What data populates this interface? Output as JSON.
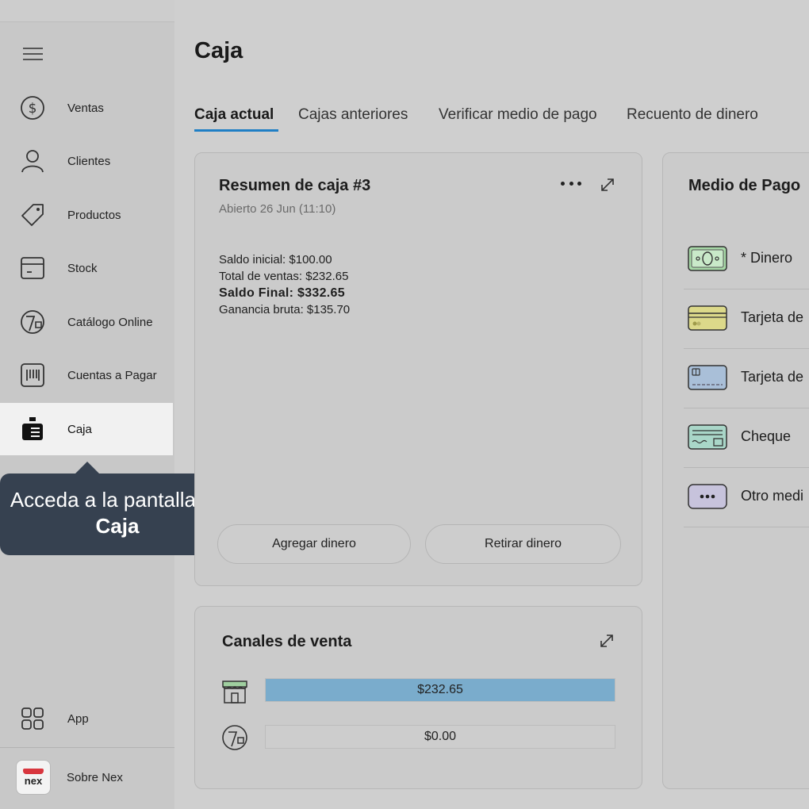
{
  "sidebar": {
    "items": [
      {
        "label": "Ventas",
        "icon": "dollar-circle-icon"
      },
      {
        "label": "Clientes",
        "icon": "user-icon"
      },
      {
        "label": "Productos",
        "icon": "tag-icon"
      },
      {
        "label": "Stock",
        "icon": "box-icon"
      },
      {
        "label": "Catálogo Online",
        "icon": "catalog-icon"
      },
      {
        "label": "Cuentas a Pagar",
        "icon": "barcode-icon"
      },
      {
        "label": "Caja",
        "icon": "cash-register-icon"
      }
    ],
    "app_label": "App",
    "about_label": "Sobre Nex",
    "logo_text": "nex"
  },
  "tooltip": {
    "text_before": "Acceda a la pantalla de ",
    "text_bold": "Caja"
  },
  "page": {
    "title": "Caja",
    "tabs": [
      "Caja actual",
      "Cajas anteriores",
      "Verificar medio de pago",
      "Recuento de dinero"
    ],
    "active_tab": "Caja actual"
  },
  "summary": {
    "title": "Resumen de caja #3",
    "subtitle": "Abierto 26 Jun (11:10)",
    "lines": [
      "Saldo inicial: $100.00",
      "Total de ventas: $232.65",
      "Saldo Final: $332.65",
      "Ganancia bruta: $135.70"
    ],
    "add_button": "Agregar dinero",
    "remove_button": "Retirar dinero"
  },
  "channels": {
    "title": "Canales de venta",
    "rows": [
      {
        "value": "$232.65",
        "fill": 1.0,
        "icon": "store-icon"
      },
      {
        "value": "$0.00",
        "fill": 0.0,
        "icon": "catalog-icon"
      }
    ],
    "bar_color": "#7aaccc"
  },
  "payments": {
    "title": "Medio de Pago",
    "items": [
      {
        "label": "* Dinero",
        "icon": "cash-icon"
      },
      {
        "label": "Tarjeta de",
        "icon": "credit-card-icon"
      },
      {
        "label": "Tarjeta de",
        "icon": "debit-card-icon"
      },
      {
        "label": "Cheque",
        "icon": "cheque-icon"
      },
      {
        "label": "Otro medi",
        "icon": "more-icon"
      }
    ]
  },
  "colors": {
    "accent": "#1f7fc5",
    "tooltip_bg": "#364150",
    "logo_red": "#d8363e"
  }
}
